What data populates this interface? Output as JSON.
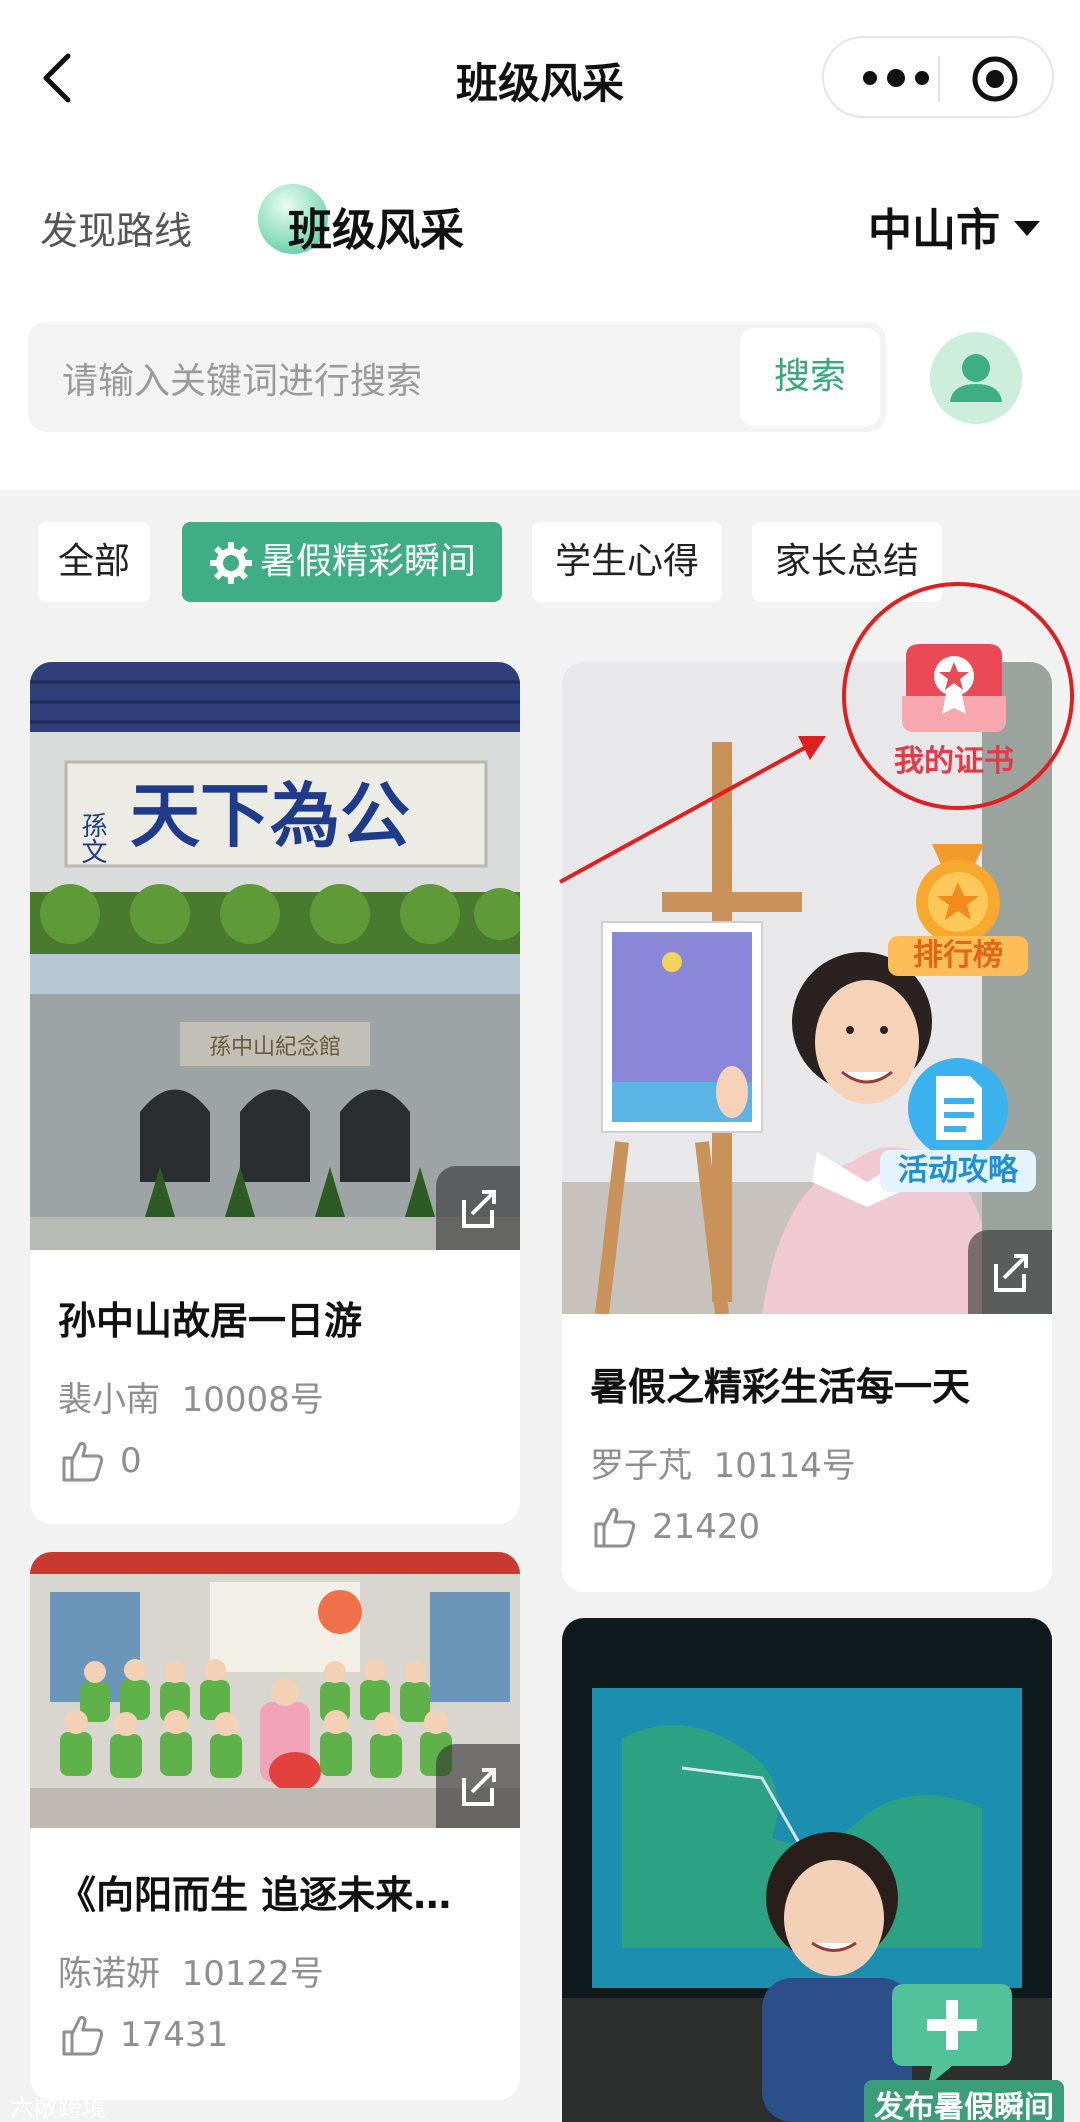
{
  "nav": {
    "title": "班级风采",
    "back_icon": "chevron-left-icon",
    "more_icon": "more-dots-icon",
    "close_icon": "target-icon"
  },
  "tabs": {
    "inactive": "发现路线",
    "active": "班级风采",
    "city": "中山市"
  },
  "search": {
    "placeholder": "请输入关键词进行搜索",
    "button_label": "搜索",
    "profile_icon": "user-icon"
  },
  "chips": [
    {
      "label": "全部",
      "active": false
    },
    {
      "label": "暑假精彩瞬间",
      "active": true,
      "icon": "gear-icon"
    },
    {
      "label": "学生心得",
      "active": false
    },
    {
      "label": "家长总结",
      "active": false
    }
  ],
  "float_buttons": {
    "certificate": "我的证书",
    "ranking": "排行榜",
    "guide": "活动攻略",
    "publish": "发布暑假瞬间"
  },
  "cards": [
    {
      "title": "孙中山故居一日游",
      "author": "裴小南",
      "number": "10008号",
      "likes": "0",
      "img_text_top": "天下為公",
      "img_text_side": "孫文",
      "img_text_bottom": "孫中山紀念館"
    },
    {
      "title": "暑假之精彩生活每一天",
      "author": "罗子芃",
      "number": "10114号",
      "likes": "21420"
    },
    {
      "title": "《向阳而生 追逐未来…",
      "author": "陈诺妍",
      "number": "10122号",
      "likes": "17431"
    },
    {
      "title": ""
    }
  ],
  "watermark": "六敞跨境",
  "colors": {
    "accent": "#3fae86",
    "search_btn_text": "#36a97b",
    "annotation": "#e02020"
  }
}
